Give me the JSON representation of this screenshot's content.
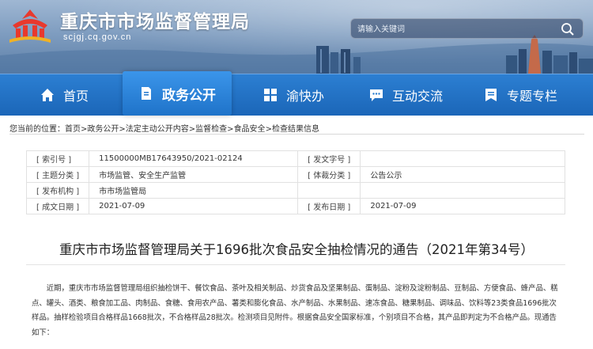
{
  "header": {
    "site_title": "重庆市市场监督管理局",
    "domain": "scjgj.cq.gov.cn",
    "search_placeholder": "请输入关键词"
  },
  "nav": [
    {
      "label": "首页",
      "icon": "home-icon"
    },
    {
      "label": "政务公开",
      "icon": "document-icon",
      "active": true
    },
    {
      "label": "渝快办",
      "icon": "grid-icon"
    },
    {
      "label": "互动交流",
      "icon": "chat-icon"
    },
    {
      "label": "专题专栏",
      "icon": "bookmark-icon"
    }
  ],
  "breadcrumb": {
    "prefix": "您当前的位置：",
    "items": [
      "首页",
      "政务公开",
      "法定主动公开内容",
      "监督检查",
      "食品安全",
      "检查结果信息"
    ],
    "separator": ">"
  },
  "info_table": {
    "rows": [
      {
        "k1": "[ 索引号 ]",
        "v1": "11500000MB17643950/2021-02124",
        "k2": "[ 发文字号 ]",
        "v2": ""
      },
      {
        "k1": "[ 主题分类 ]",
        "v1": "市场监管、安全生产监管",
        "k2": "[ 体裁分类 ]",
        "v2": "公告公示"
      },
      {
        "k1": "[ 发布机构 ]",
        "v1": "市市场监管局",
        "k2": "",
        "v2": ""
      },
      {
        "k1": "[ 成文日期 ]",
        "v1": "2021-07-09",
        "k2": "[ 发布日期 ]",
        "v2": "2021-07-09"
      }
    ]
  },
  "article": {
    "title": "重庆市市场监督管理局关于1696批次食品安全抽检情况的通告（2021年第34号）",
    "paragraph": "近期，重庆市市场监督管理局组织抽检饼干、餐饮食品、茶叶及相关制品、炒货食品及坚果制品、蛋制品、淀粉及淀粉制品、豆制品、方便食品、蜂产品、糕点、罐头、酒类、粮食加工品、肉制品、食糖、食用农产品、薯类和膨化食品、水产制品、水果制品、速冻食品、糖果制品、调味品、饮料等23类食品1696批次样品。抽样检验项目合格样品1668批次，不合格样品28批次。检测项目见附件。根据食品安全国家标准，个别项目不合格，其产品即判定为不合格产品。现通告如下："
  },
  "colors": {
    "nav_blue": "#1b66b8",
    "nav_active": "#3b95ea"
  }
}
